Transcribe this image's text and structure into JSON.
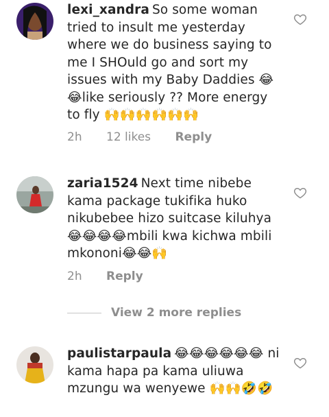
{
  "comments": [
    {
      "username": "lexi_xandra",
      "text": "So some woman tried to insult me yesterday where we do business saying to me I SHOuld go and sort my issues with my Baby Daddies 😂😂like seriously ?? More energy to fly 🙌🙌🙌🙌🙌🙌",
      "time": "2h",
      "likes": "12 likes",
      "reply": "Reply"
    },
    {
      "username": "zaria1524",
      "text": "Next time nibebe kama package tukifika huko nikubebee hizo suitcase kiluhya😂😂😂😂mbili kwa kichwa mbili mkononi😂😂🙌",
      "time": "2h",
      "reply": "Reply"
    },
    {
      "username": "paulistarpaula",
      "text": "😂😂😂😂😂😂 ni kama hapa pa kama uliuwa mzungu wa wenyewe 🙌🙌🤣🤣"
    }
  ],
  "view_more": "View 2 more replies",
  "icons": {
    "like": "heart-outline-icon"
  }
}
